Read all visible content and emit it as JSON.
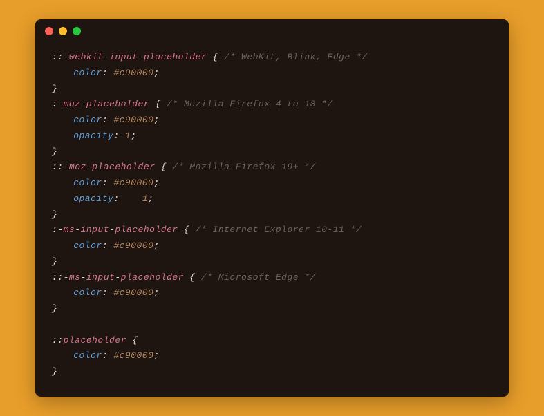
{
  "window": {
    "dots": [
      "red",
      "yellow",
      "green"
    ]
  },
  "code": {
    "lines": [
      {
        "type": "sel",
        "prefix": "::-",
        "parts": [
          "webkit",
          "input",
          "placeholder"
        ],
        "comment": "/* WebKit, Blink, Edge */"
      },
      {
        "type": "prop",
        "indent": 2,
        "name": "color",
        "value": "#c90000"
      },
      {
        "type": "close"
      },
      {
        "type": "sel",
        "prefix": ":-",
        "parts": [
          "moz",
          "placeholder"
        ],
        "comment": "/* Mozilla Firefox 4 to 18 */"
      },
      {
        "type": "prop",
        "indent": 2,
        "name": "color",
        "value": "#c90000"
      },
      {
        "type": "prop",
        "indent": 2,
        "name": "opacity",
        "value": "1",
        "num": true
      },
      {
        "type": "close"
      },
      {
        "type": "sel",
        "prefix": "::-",
        "parts": [
          "moz",
          "placeholder"
        ],
        "comment": "/* Mozilla Firefox 19+ */"
      },
      {
        "type": "prop",
        "indent": 2,
        "name": "color",
        "value": "#c90000"
      },
      {
        "type": "prop",
        "indent": 2,
        "name": "opacity",
        "value": "1",
        "num": true,
        "gap": "   "
      },
      {
        "type": "close"
      },
      {
        "type": "sel",
        "prefix": ":-",
        "parts": [
          "ms",
          "input",
          "placeholder"
        ],
        "comment": "/* Internet Explorer 10-11 */"
      },
      {
        "type": "prop",
        "indent": 2,
        "name": "color",
        "value": "#c90000"
      },
      {
        "type": "close"
      },
      {
        "type": "sel",
        "prefix": "::-",
        "parts": [
          "ms",
          "input",
          "placeholder"
        ],
        "comment": "/* Microsoft Edge */"
      },
      {
        "type": "prop",
        "indent": 2,
        "name": "color",
        "value": "#c90000"
      },
      {
        "type": "close"
      },
      {
        "type": "blank"
      },
      {
        "type": "sel",
        "prefix": "::",
        "parts": [
          "placeholder"
        ],
        "comment": ""
      },
      {
        "type": "prop",
        "indent": 2,
        "name": "color",
        "value": "#c90000"
      },
      {
        "type": "close"
      }
    ]
  }
}
